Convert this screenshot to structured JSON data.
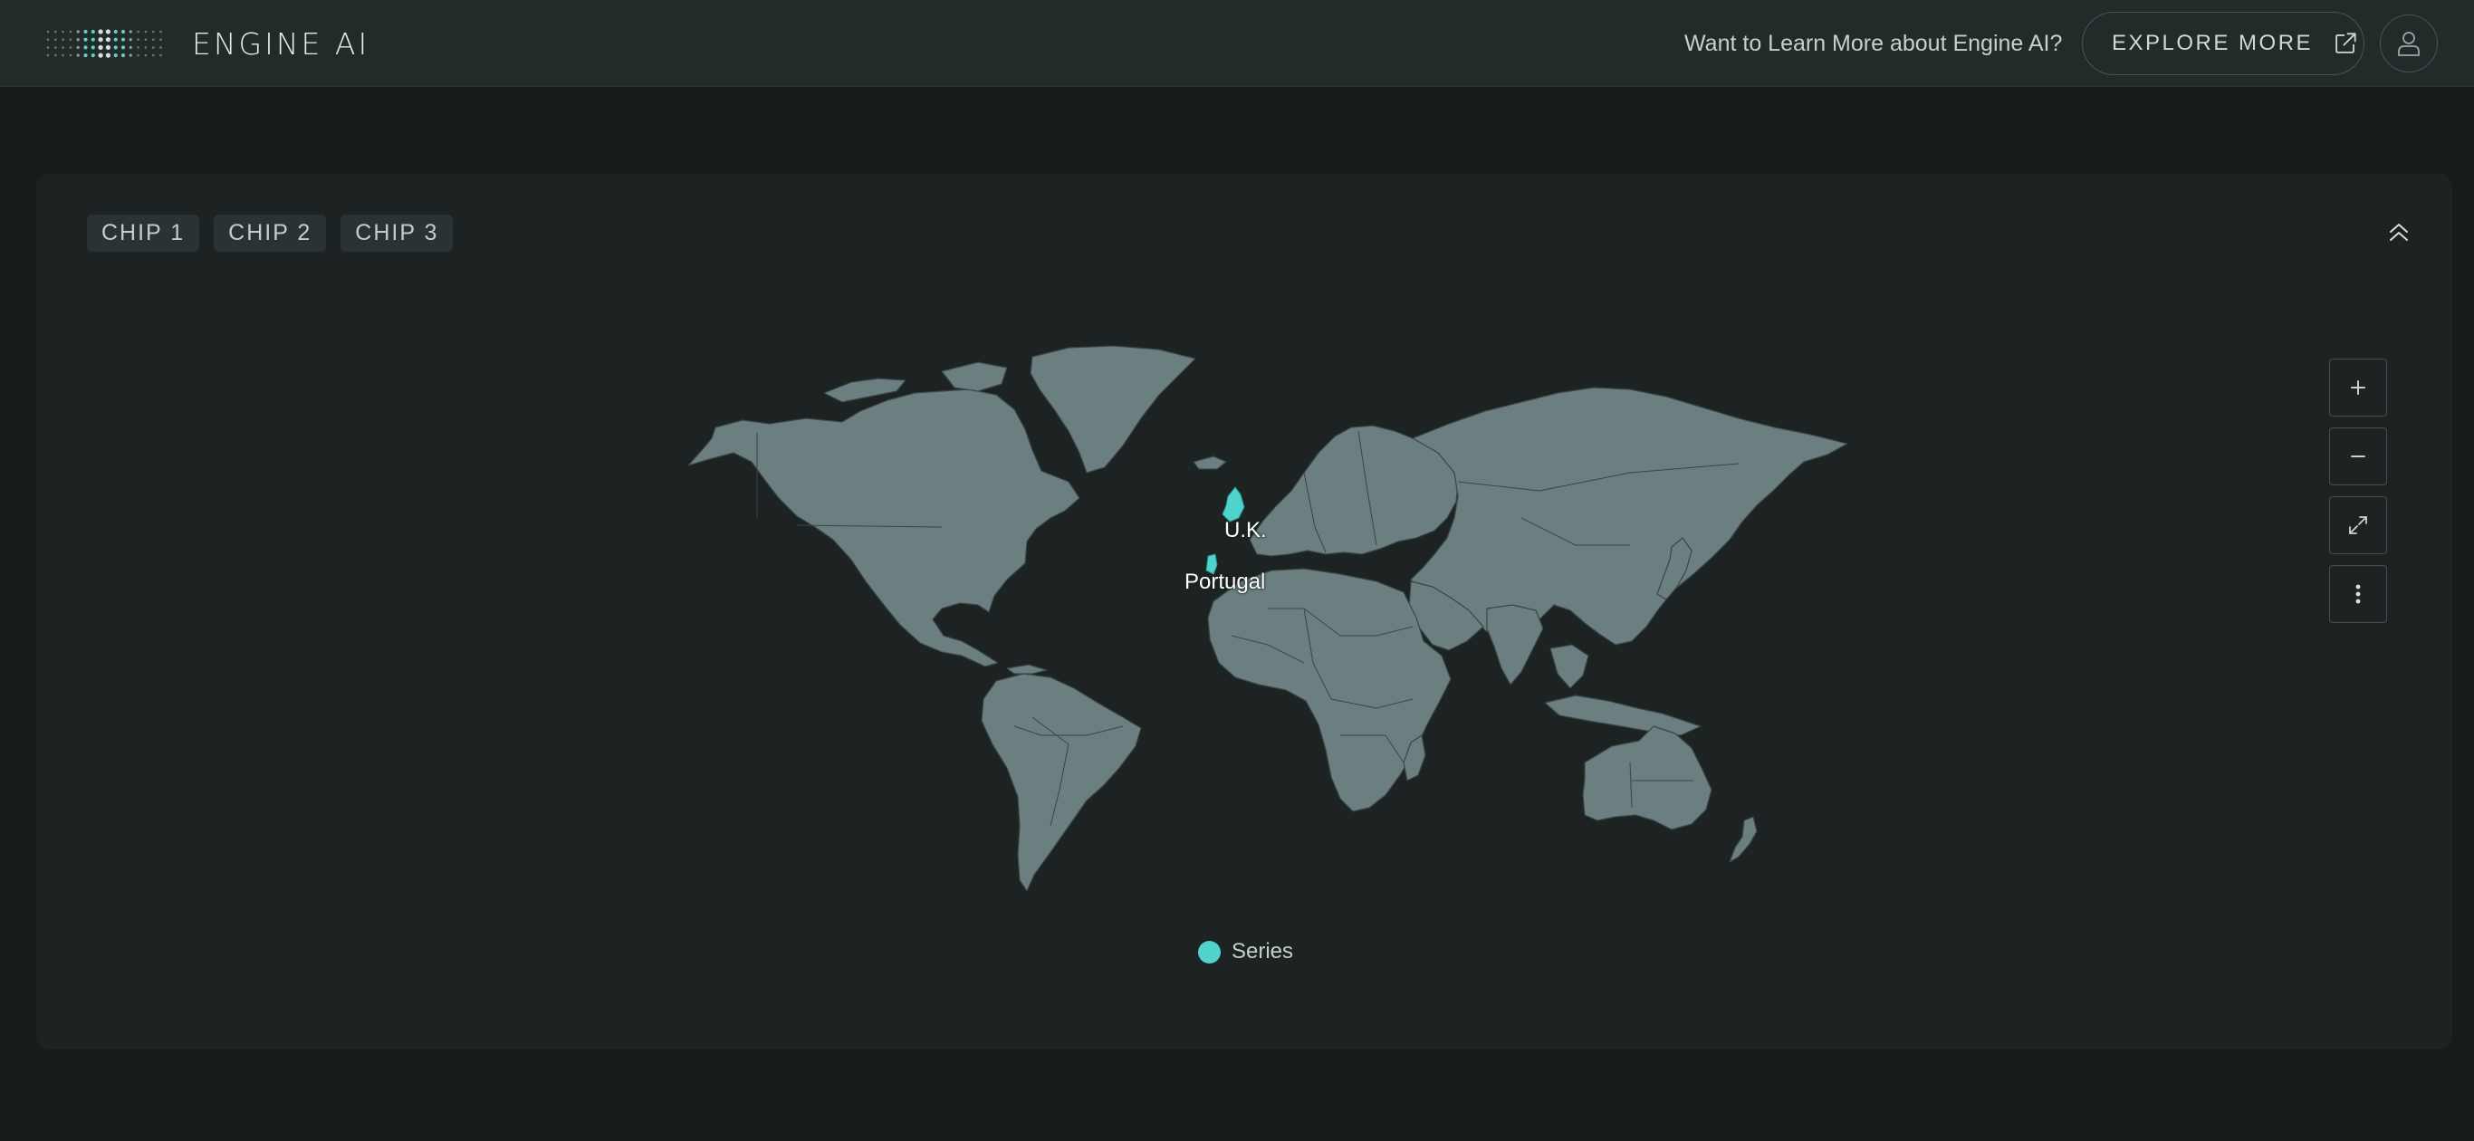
{
  "header": {
    "brand": "ENGINE AI",
    "promo_text": "Want to Learn More about Engine AI?",
    "explore_label": "EXPLORE MORE",
    "explore_icon": "external-link-icon",
    "user_icon": "user-icon"
  },
  "panel": {
    "chips": [
      {
        "label": "CHIP 1"
      },
      {
        "label": "CHIP 2"
      },
      {
        "label": "CHIP 3"
      }
    ],
    "collapse_icon": "double-chevron-up-icon"
  },
  "map": {
    "highlighted_regions": [
      {
        "label": "U.K."
      },
      {
        "label": "Portugal"
      }
    ],
    "controls": [
      {
        "icon": "plus-icon",
        "action": "zoom-in"
      },
      {
        "icon": "minus-icon",
        "action": "zoom-out"
      },
      {
        "icon": "expand-icon",
        "action": "fullscreen"
      },
      {
        "icon": "more-vertical-icon",
        "action": "menu"
      }
    ],
    "land_color": "#6b7f80",
    "border_color": "#3a4646"
  },
  "legend": {
    "series_name": "Series",
    "series_color": "#4fd3cc"
  },
  "colors": {
    "background": "#161c1c",
    "topbar": "#222a2a",
    "panel": "#1c2322",
    "accent": "#4fd3cc"
  }
}
